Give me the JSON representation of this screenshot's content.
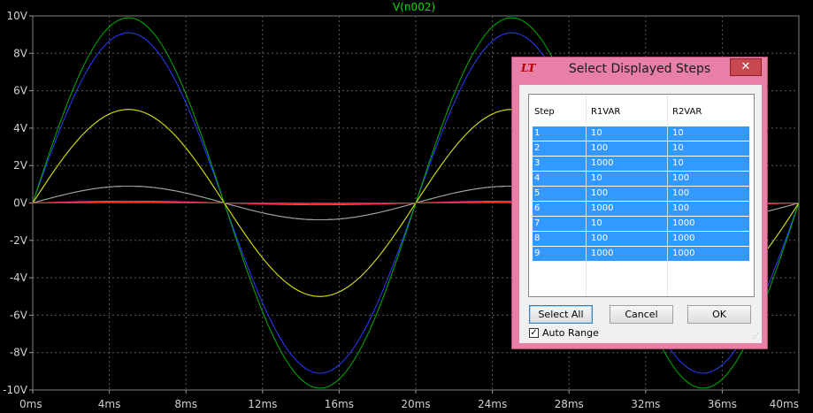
{
  "chart_data": {
    "type": "line",
    "title": "V(n002)",
    "x_ticks": [
      "0ms",
      "4ms",
      "8ms",
      "12ms",
      "16ms",
      "20ms",
      "24ms",
      "28ms",
      "32ms",
      "36ms",
      "40ms"
    ],
    "y_ticks": [
      "10V",
      "8V",
      "6V",
      "4V",
      "2V",
      "0V",
      "-2V",
      "-4V",
      "-6V",
      "-8V",
      "-10V"
    ],
    "xlim": [
      0,
      40
    ],
    "ylim": [
      -10,
      10
    ],
    "x_unit": "ms",
    "y_unit": "V",
    "grid": true,
    "waveform": "sine",
    "period_ms": 20,
    "series": [
      {
        "step": 1,
        "amplitude": 9.1,
        "color": "#2b3cff"
      },
      {
        "step": 2,
        "amplitude": 5.0,
        "color": "#e8b000"
      },
      {
        "step": 3,
        "amplitude": 0.9,
        "color": "#c8c8c8"
      },
      {
        "step": 4,
        "amplitude": 9.9,
        "color": "#00b000"
      },
      {
        "step": 5,
        "amplitude": 5.0,
        "color": "#cfe000"
      },
      {
        "step": 6,
        "amplitude": 0.9,
        "color": "#a0a0a0"
      },
      {
        "step": 7,
        "amplitude": 0.1,
        "color": "#d040d0"
      },
      {
        "step": 8,
        "amplitude": 0.05,
        "color": "#ff3030"
      },
      {
        "step": 9,
        "amplitude": 0.01,
        "color": "#ff2020"
      }
    ]
  },
  "dialog": {
    "title": "Select Displayed Steps",
    "app_icon": "ltspice-logo-icon",
    "close_label": "✕",
    "columns": [
      "Step",
      "R1VAR",
      "R2VAR"
    ],
    "rows": [
      [
        "1",
        "10",
        "10"
      ],
      [
        "2",
        "100",
        "10"
      ],
      [
        "3",
        "1000",
        "10"
      ],
      [
        "4",
        "10",
        "100"
      ],
      [
        "5",
        "100",
        "100"
      ],
      [
        "6",
        "1000",
        "100"
      ],
      [
        "7",
        "10",
        "1000"
      ],
      [
        "8",
        "100",
        "1000"
      ],
      [
        "9",
        "1000",
        "1000"
      ]
    ],
    "buttons": {
      "select_all": "Select All",
      "cancel": "Cancel",
      "ok": "OK"
    },
    "auto_range": {
      "label": "Auto Range",
      "checked": true
    },
    "colors": {
      "frame": "#e87fa6",
      "selection": "#3399ff"
    }
  }
}
